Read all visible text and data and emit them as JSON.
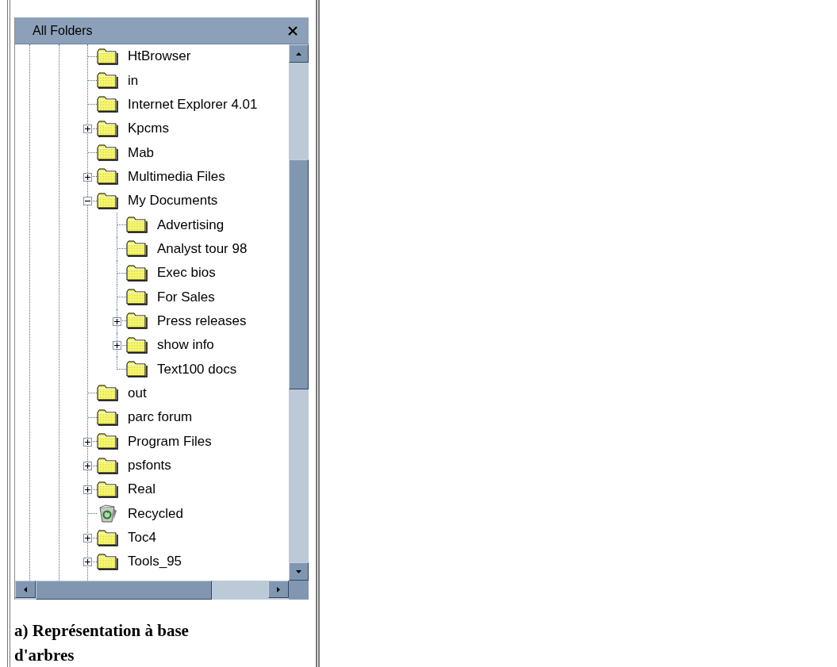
{
  "panel": {
    "title": "All Folders"
  },
  "tree": [
    {
      "label": "HtBrowser",
      "kind": "folder"
    },
    {
      "label": "in",
      "kind": "folder"
    },
    {
      "label": "Internet Explorer 4.01",
      "kind": "folder"
    },
    {
      "label": "Kpcms",
      "kind": "folder",
      "expanded": false
    },
    {
      "label": "Mab",
      "kind": "folder"
    },
    {
      "label": "Multimedia Files",
      "kind": "folder",
      "expanded": false
    },
    {
      "label": "My Documents",
      "kind": "folder",
      "expanded": true,
      "children": [
        {
          "label": "Advertising",
          "kind": "folder"
        },
        {
          "label": "Analyst tour 98",
          "kind": "folder"
        },
        {
          "label": "Exec bios",
          "kind": "folder"
        },
        {
          "label": "For Sales",
          "kind": "folder"
        },
        {
          "label": "Press releases",
          "kind": "folder",
          "expanded": false
        },
        {
          "label": "show info",
          "kind": "folder",
          "expanded": false
        },
        {
          "label": "Text100 docs",
          "kind": "folder"
        }
      ]
    },
    {
      "label": "out",
      "kind": "folder"
    },
    {
      "label": "parc forum",
      "kind": "folder"
    },
    {
      "label": "Program Files",
      "kind": "folder",
      "expanded": false
    },
    {
      "label": "psfonts",
      "kind": "folder",
      "expanded": false
    },
    {
      "label": "Real",
      "kind": "folder",
      "expanded": false
    },
    {
      "label": "Recycled",
      "kind": "recycle-bin"
    },
    {
      "label": "Toc4",
      "kind": "folder",
      "expanded": false
    },
    {
      "label": "Tools_95",
      "kind": "folder",
      "expanded": false
    }
  ],
  "caption": "a) Représentation à base d'arbres"
}
